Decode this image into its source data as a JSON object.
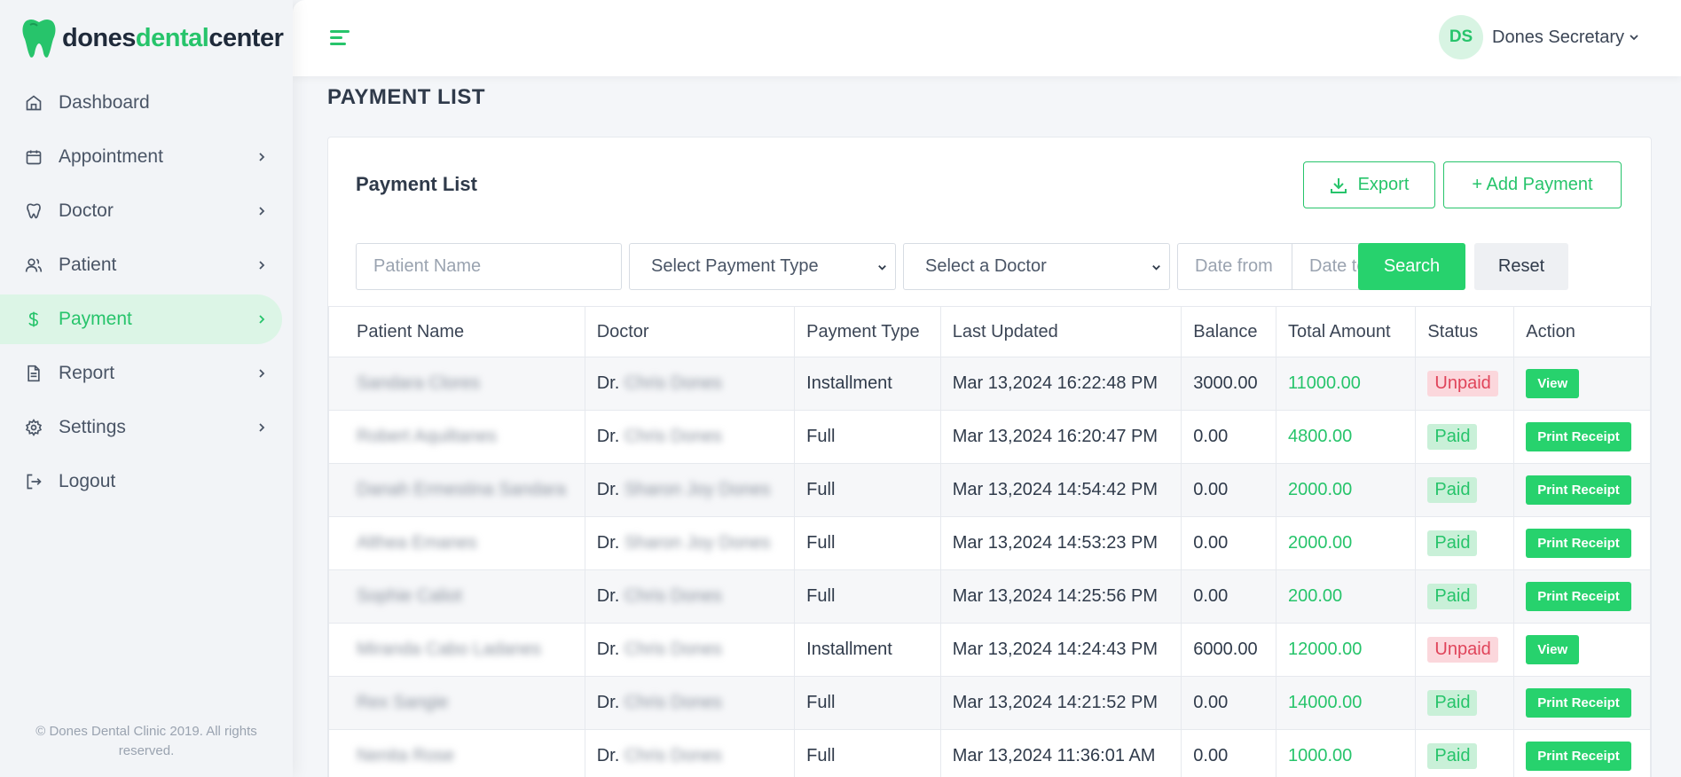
{
  "brand": {
    "part1": "dones",
    "part2": "dental",
    "part3": "center"
  },
  "nav": [
    {
      "label": "Dashboard",
      "icon": "home-icon"
    },
    {
      "label": "Appointment",
      "icon": "calendar-icon"
    },
    {
      "label": "Doctor",
      "icon": "tooth-icon"
    },
    {
      "label": "Patient",
      "icon": "users-icon"
    },
    {
      "label": "Payment",
      "icon": "dollar-icon"
    },
    {
      "label": "Report",
      "icon": "file-icon"
    },
    {
      "label": "Settings",
      "icon": "gear-icon"
    },
    {
      "label": "Logout",
      "icon": "logout-icon"
    }
  ],
  "footer": "© Dones Dental Clinic 2019. All rights reserved.",
  "header": {
    "avatar_initials": "DS",
    "user_name": "Dones Secretary"
  },
  "page_title": "PAYMENT LIST",
  "card": {
    "title": "Payment List",
    "export_label": "Export",
    "add_label": "+ Add Payment"
  },
  "filters": {
    "patient_placeholder": "Patient Name",
    "payment_type_selected": "Select Payment Type",
    "doctor_selected": "Select a Doctor",
    "date_from_placeholder": "Date from",
    "date_to_placeholder": "Date to",
    "search_label": "Search",
    "reset_label": "Reset"
  },
  "table": {
    "headers": [
      "Patient Name",
      "Doctor",
      "Payment Type",
      "Last Updated",
      "Balance",
      "Total Amount",
      "Status",
      "Action"
    ],
    "rows": [
      {
        "patient": "Sandara Clores",
        "doctor_prefix": "Dr.",
        "doctor": "Chris Dones",
        "type": "Installment",
        "updated": "Mar 13,2024 16:22:48 PM",
        "balance": "3000.00",
        "total": "11000.00",
        "status": "Unpaid",
        "action": "View"
      },
      {
        "patient": "Robert Aquiltanes",
        "doctor_prefix": "Dr.",
        "doctor": "Chris Dones",
        "type": "Full",
        "updated": "Mar 13,2024 16:20:47 PM",
        "balance": "0.00",
        "total": "4800.00",
        "status": "Paid",
        "action": "Print Receipt"
      },
      {
        "patient": "Danah Ermestina Sandara",
        "doctor_prefix": "Dr.",
        "doctor": "Sharon Joy Dones",
        "type": "Full",
        "updated": "Mar 13,2024 14:54:42 PM",
        "balance": "0.00",
        "total": "2000.00",
        "status": "Paid",
        "action": "Print Receipt"
      },
      {
        "patient": "Althea Emanes",
        "doctor_prefix": "Dr.",
        "doctor": "Sharon Joy Dones",
        "type": "Full",
        "updated": "Mar 13,2024 14:53:23 PM",
        "balance": "0.00",
        "total": "2000.00",
        "status": "Paid",
        "action": "Print Receipt"
      },
      {
        "patient": "Sophie Caliot",
        "doctor_prefix": "Dr.",
        "doctor": "Chris Dones",
        "type": "Full",
        "updated": "Mar 13,2024 14:25:56 PM",
        "balance": "0.00",
        "total": "200.00",
        "status": "Paid",
        "action": "Print Receipt"
      },
      {
        "patient": "Miranda Cabo Ladanes",
        "doctor_prefix": "Dr.",
        "doctor": "Chris Dones",
        "type": "Installment",
        "updated": "Mar 13,2024 14:24:43 PM",
        "balance": "6000.00",
        "total": "12000.00",
        "status": "Unpaid",
        "action": "View"
      },
      {
        "patient": "Rex Sangie",
        "doctor_prefix": "Dr.",
        "doctor": "Chris Dones",
        "type": "Full",
        "updated": "Mar 13,2024 14:21:52 PM",
        "balance": "0.00",
        "total": "14000.00",
        "status": "Paid",
        "action": "Print Receipt"
      },
      {
        "patient": "Nenita Rose",
        "doctor_prefix": "Dr.",
        "doctor": "Chris Dones",
        "type": "Full",
        "updated": "Mar 13,2024 11:36:01 AM",
        "balance": "0.00",
        "total": "1000.00",
        "status": "Paid",
        "action": "Print Receipt"
      }
    ]
  },
  "colors": {
    "accent": "#27c46b",
    "unpaid": "#e0445a"
  }
}
